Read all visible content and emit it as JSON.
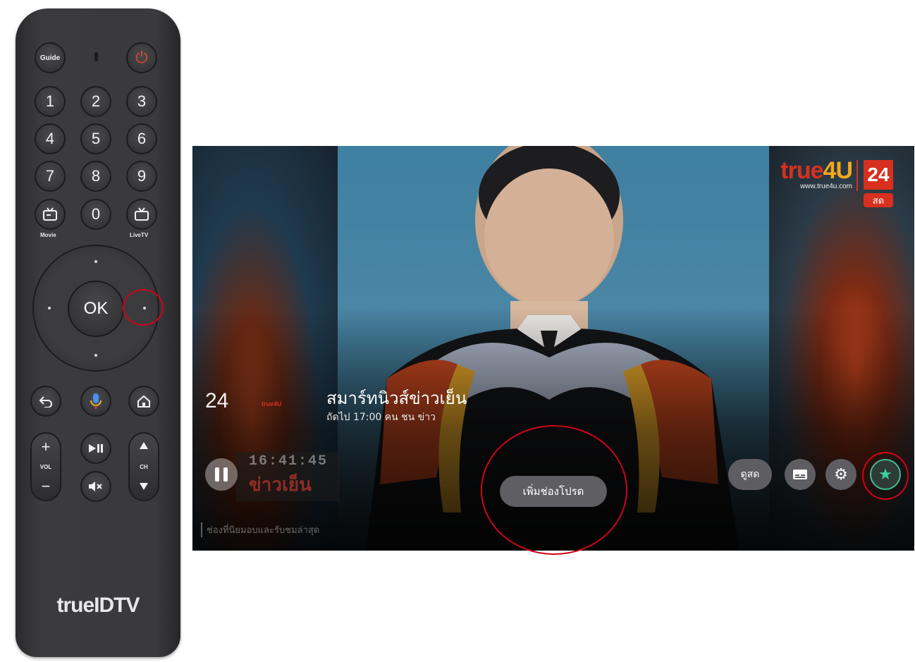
{
  "remote": {
    "guide_label": "Guide",
    "power_symbol": "⏻",
    "digits": [
      "1",
      "2",
      "3",
      "4",
      "5",
      "6",
      "7",
      "8",
      "9",
      "0"
    ],
    "movie_caption": "Movie",
    "livetv_caption": "LiveTV",
    "ok_label": "OK",
    "vol_label": "VOL",
    "ch_label": "CH",
    "plus": "+",
    "minus": "−",
    "brand": "trueIDTV"
  },
  "tv": {
    "channel_number": "24",
    "channel_logo_small": "true4U",
    "program_title": "สมาร์ทนิวส์ข่าวเย็น",
    "program_next": "ถัดไป 17:00 คน ชน ข่าว",
    "brand_true": "true",
    "brand_four": "4U",
    "brand_url": "www.true4u.com",
    "brand_channel": "24",
    "live_tag": "สด",
    "ticker_time": "16:41:45",
    "ticker_news": "ข่าวเย็น",
    "footer_note": "ช่องที่นิยมอบและรับชมล่าสุด",
    "toast": "เพิ่มช่องโปรด",
    "watch_live_label": "ดูสด",
    "icons": {
      "pause": "pause-icon",
      "subtitles": "subtitles-icon",
      "settings": "gear-icon",
      "favorite": "star-icon"
    },
    "accent": "#d7301f",
    "favorite_color": "#3bd39d",
    "highlight_color": "#d0021b"
  }
}
